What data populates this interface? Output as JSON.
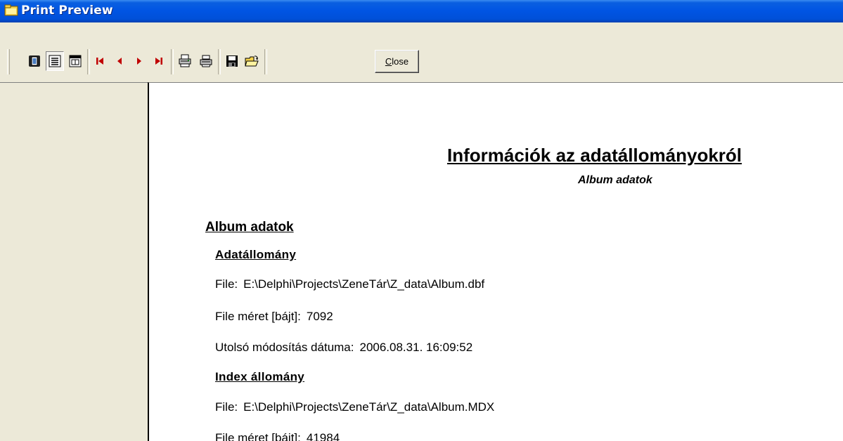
{
  "window": {
    "title": "Print Preview"
  },
  "toolbar": {
    "buttons": [
      {
        "name": "whole-page-icon"
      },
      {
        "name": "page-width-icon"
      },
      {
        "name": "zoom-100-icon"
      },
      {
        "name": "first-page-icon"
      },
      {
        "name": "previous-page-icon"
      },
      {
        "name": "next-page-icon"
      },
      {
        "name": "last-page-icon"
      },
      {
        "name": "printer-setup-icon"
      },
      {
        "name": "print-icon"
      },
      {
        "name": "save-icon"
      },
      {
        "name": "open-icon"
      }
    ],
    "close_label": "Close",
    "close_accel": "C",
    "close_rest": "lose"
  },
  "report": {
    "title": "Információk az adatállományokról",
    "subtitle": "Album adatok",
    "section_heading": "Album adatok",
    "data_file": {
      "heading": "Adatállomány",
      "file_label": "File:",
      "file_value": "E:\\Delphi\\Projects\\ZeneTár\\Z_data\\Album.dbf",
      "size_label": "File méret [bájt]:",
      "size_value": "7092",
      "modified_label": "Utolsó módosítás dátuma:",
      "modified_value": "2006.08.31. 16:09:52"
    },
    "index_file": {
      "heading": "Index állomány",
      "file_label": "File:",
      "file_value": "E:\\Delphi\\Projects\\ZeneTár\\Z_data\\Album.MDX",
      "size_label": "File méret [bájt]:",
      "size_value": "41984"
    }
  },
  "colors": {
    "titlebar": "#0054e3",
    "chrome": "#ece9d8",
    "nav_arrows": "#c00000"
  }
}
